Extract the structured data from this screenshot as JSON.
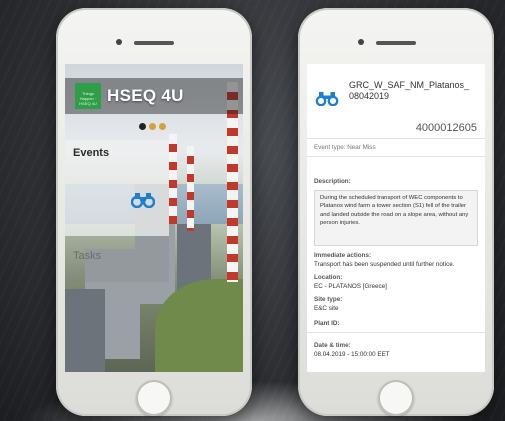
{
  "left_phone": {
    "app_title": "HSEQ 4U",
    "logo_text": "Things Happen · HSEQ 4U",
    "carousel_dots": [
      "#222222",
      "#d4a23a",
      "#d4a23a"
    ],
    "tiles": [
      {
        "label": "Events",
        "icon": "binoculars-icon"
      },
      {
        "label": "Tasks"
      }
    ]
  },
  "right_phone": {
    "header_icon": "binoculars-icon",
    "event_id": "GRC_W_SAF_NM_Platanos_08042019",
    "event_number": "4000012605",
    "event_type": "Event type: Near Miss",
    "description_label": "Description:",
    "description": "During the scheduled transport of WEC components to Platanos wind farm a tower section (S1) fell of the trailer and landed outside the road on a slope area, without any person injuries.",
    "immediate_actions_label": "Immediate actions:",
    "immediate_actions": "Transport has been suspended until further notice.",
    "location_label": "Location:",
    "location": "EC - PLATANOS [Greece]",
    "site_type_label": "Site type:",
    "site_type": "E&C site",
    "plant_id_label": "Plant ID:",
    "date_time_label": "Date & time:",
    "date_time": "08.04.2019 - 15:00:00 EET"
  },
  "colors": {
    "accent_blue": "#1e7fd0",
    "logo_green": "#2e9e48"
  }
}
